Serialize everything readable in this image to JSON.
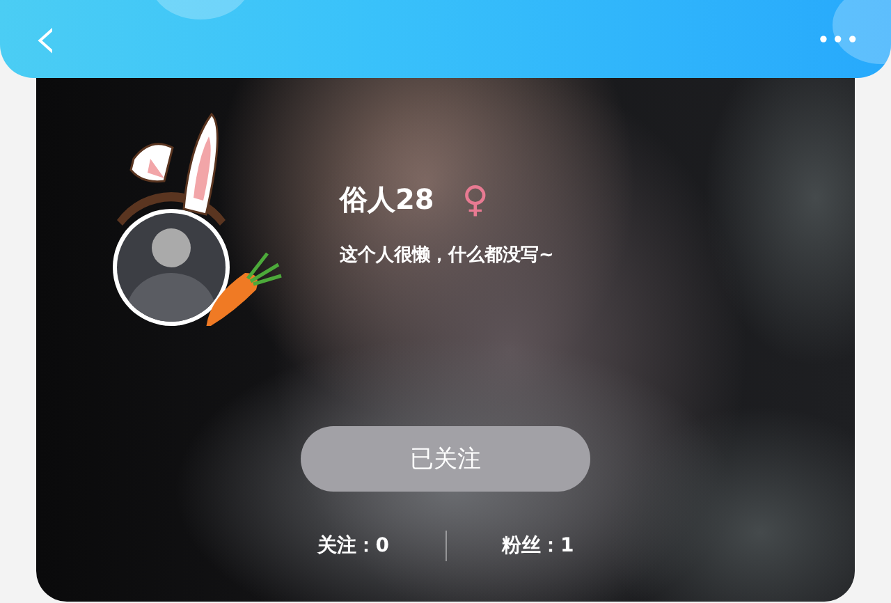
{
  "header": {
    "back_icon": "‹",
    "menu_icon": "•••"
  },
  "profile": {
    "name": "俗人28",
    "gender_symbol": "♀",
    "bio": "这个人很懒，什么都没写~",
    "follow_button": {
      "label": "已关注",
      "followed": true
    },
    "stats": [
      {
        "text": "关注：0"
      },
      {
        "text": "粉丝：1"
      }
    ]
  }
}
